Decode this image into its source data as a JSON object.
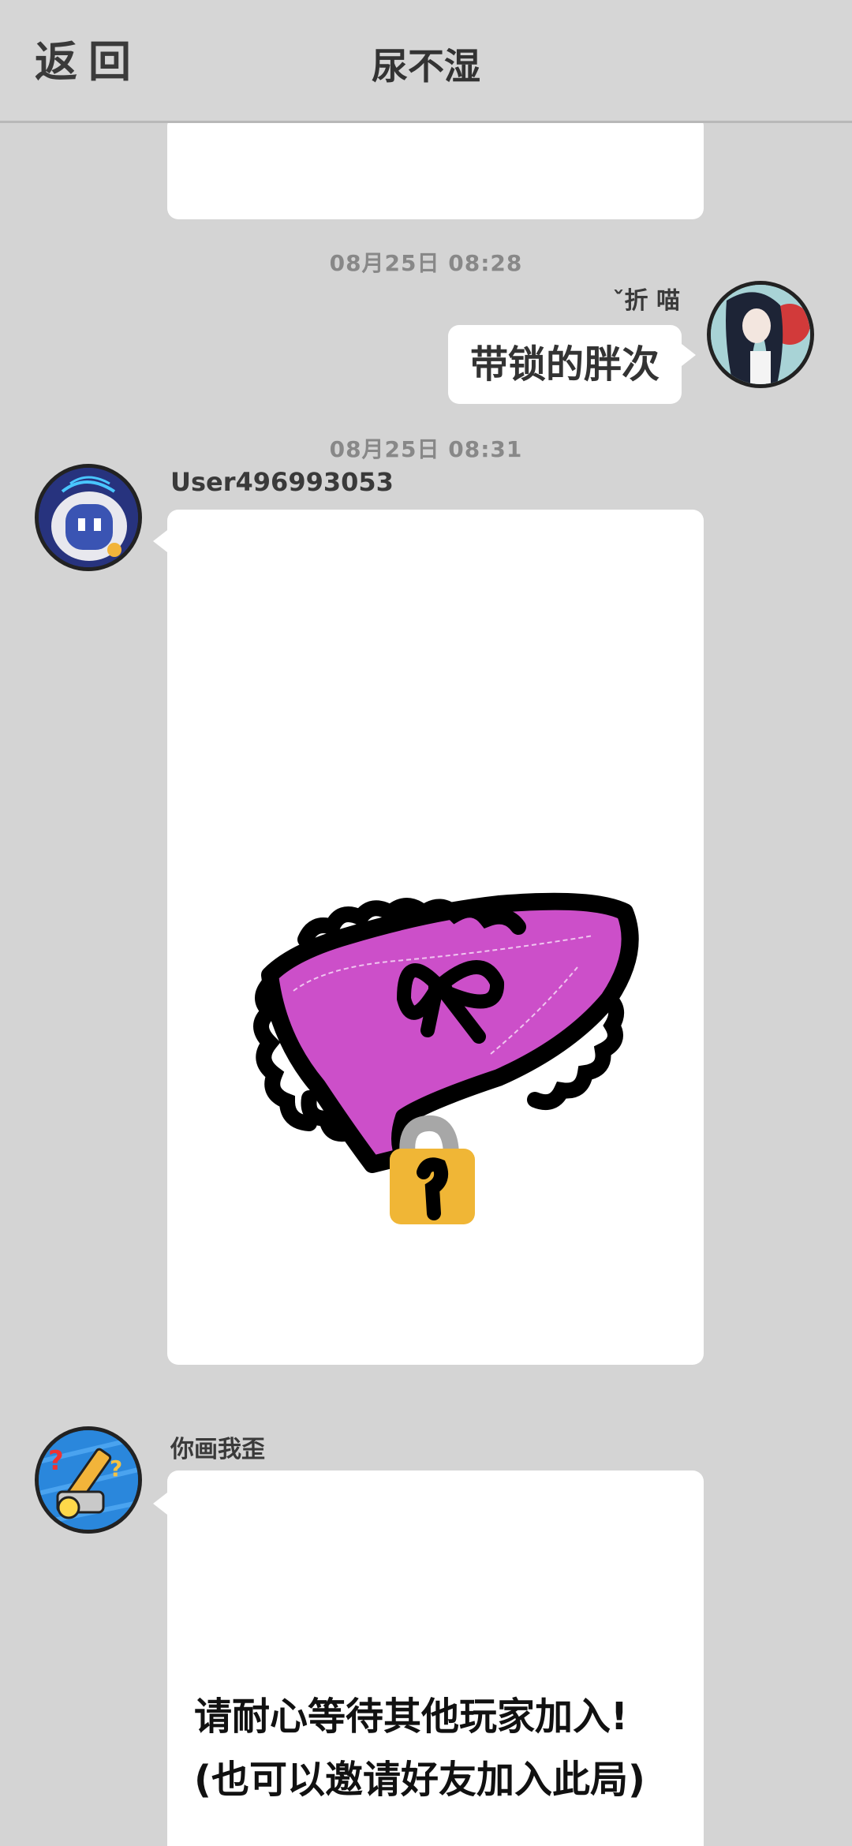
{
  "header": {
    "back_label": "返回",
    "title": "尿不湿"
  },
  "messages": [
    {
      "timestamp": "08月25日  08:28",
      "sender": "‪折喵",
      "sender_display": "ˇ折 喵",
      "text": "带锁的胖次",
      "side": "right"
    },
    {
      "timestamp": "08月25日  08:31",
      "sender": "User496993053",
      "content": "drawing: padlocked panties",
      "side": "left"
    },
    {
      "sender": "你画我歪",
      "text_line1": "请耐心等待其他玩家加入!",
      "text_line2": "(也可以邀请好友加入此局)",
      "side": "left"
    }
  ],
  "colors": {
    "background": "#d4d4d4",
    "card": "#ffffff",
    "drawing_fill": "#cc4fc9",
    "lock": "#f0b636"
  }
}
